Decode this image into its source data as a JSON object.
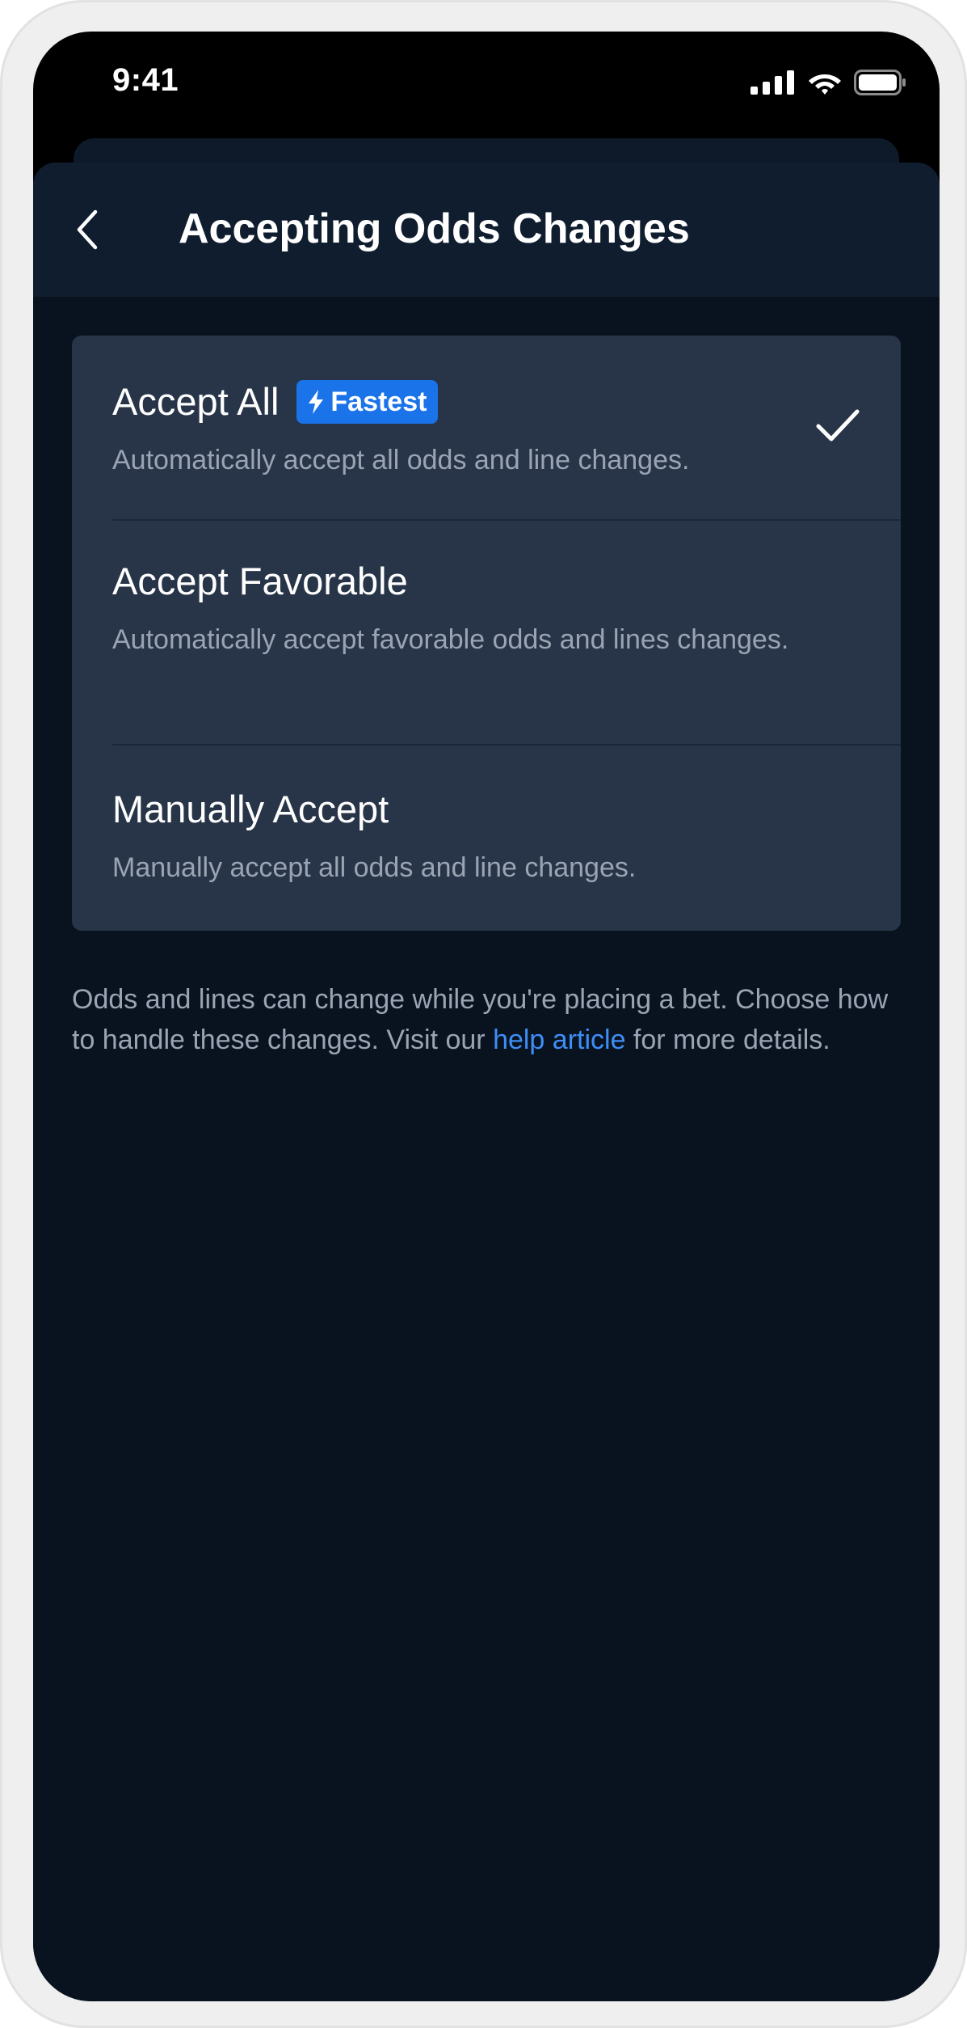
{
  "status_bar": {
    "time": "9:41",
    "icons": [
      "signal-icon",
      "wifi-icon",
      "battery-icon"
    ]
  },
  "header": {
    "back_icon": "chevron-left-icon",
    "title": "Accepting Odds Changes"
  },
  "options": [
    {
      "title": "Accept All",
      "badge": "Fastest",
      "badge_icon": "lightning-icon",
      "description": "Automatically accept all odds and line changes.",
      "selected": true
    },
    {
      "title": "Accept Favorable",
      "description": "Automatically accept favorable odds and lines changes.",
      "selected": false
    },
    {
      "title": "Manually Accept",
      "description": "Manually accept all odds and line changes.",
      "selected": false
    }
  ],
  "footnote": {
    "text_before": "Odds and lines can change while you're placing a bet. Choose how to handle these changes. Visit our ",
    "link_text": "help article",
    "text_after": " for more details."
  },
  "colors": {
    "background": "#091320",
    "header": "#0f1d2f",
    "card": "#283549",
    "badge": "#1a73e8",
    "link": "#3d8ef7",
    "secondary_text": "#9aa4b3"
  }
}
